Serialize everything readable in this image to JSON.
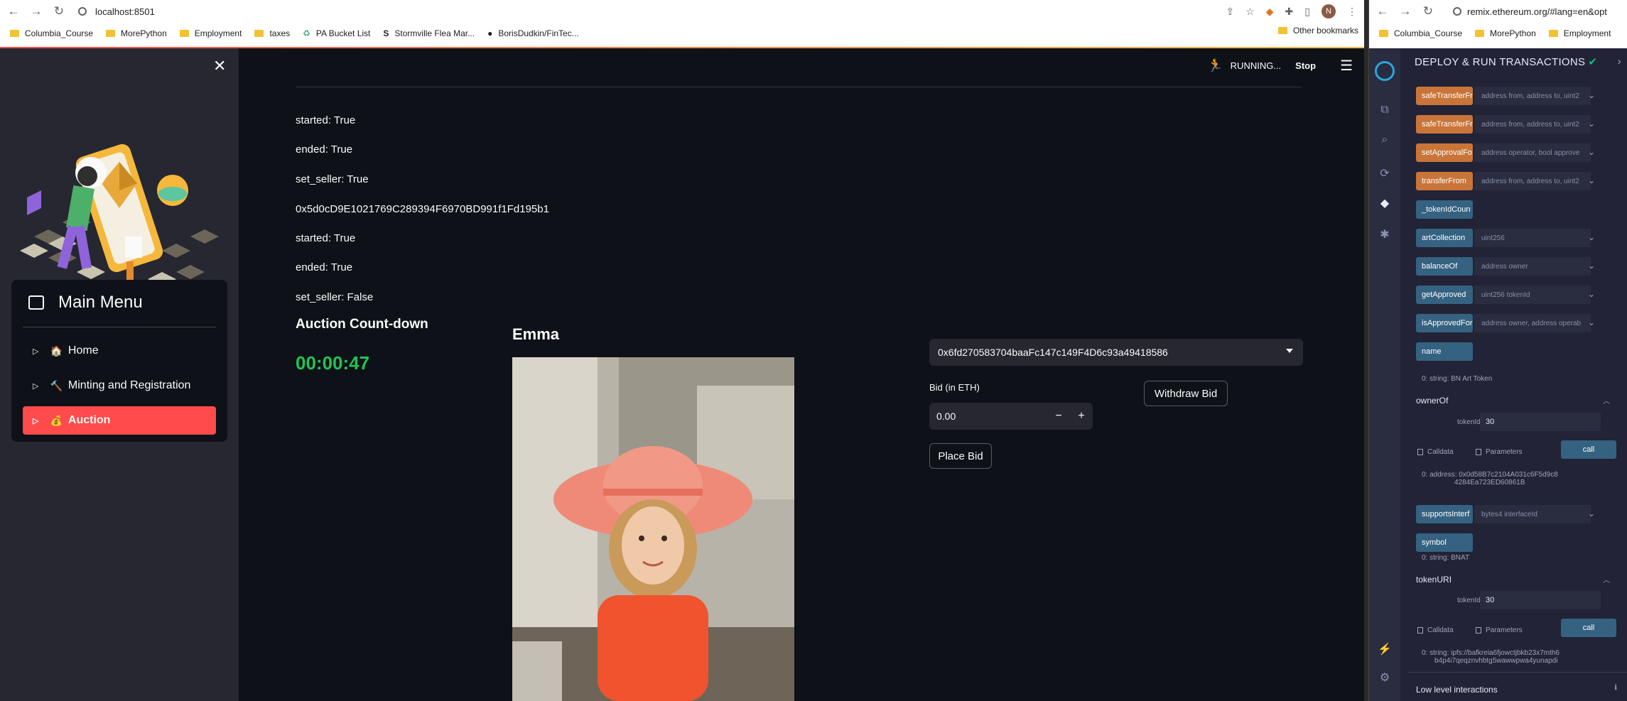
{
  "left_browser": {
    "url": "localhost:8501",
    "bookmarks": [
      "Columbia_Course",
      "MorePython",
      "Employment",
      "taxes",
      "PA Bucket List",
      "Stormville Flea Mar...",
      "BorisDudkin/FinTec..."
    ],
    "other_bookmarks": "Other bookmarks",
    "profile_initial": "N"
  },
  "app": {
    "running_label": "RUNNING...",
    "stop_label": "Stop",
    "sidebar": {
      "menu_title": "Main Menu",
      "items": [
        {
          "emoji": "🏠",
          "label": "Home"
        },
        {
          "emoji": "🔨",
          "label": "Minting and Registration"
        },
        {
          "emoji": "💰",
          "label": "Auction"
        }
      ]
    },
    "status_lines": [
      "started: True",
      "ended: True",
      "set_seller: True",
      "0x5d0cD9E1021769C289394F6970BD991f1Fd195b1",
      "started: True",
      "ended: True",
      "set_seller: False"
    ],
    "countdown_title": "Auction Count-down",
    "countdown_value": "00:00:47",
    "artwork_title": "Emma",
    "account_select": "0x6fd270583704baaFc147c149F4D6c93a49418586",
    "bid_label": "Bid (in ETH)",
    "bid_value": "0.00",
    "withdraw_label": "Withdraw Bid",
    "place_bid_label": "Place Bid"
  },
  "right_browser": {
    "url": "remix.ethereum.org/#lang=en&opt",
    "bookmarks": [
      "Columbia_Course",
      "MorePython",
      "Employment"
    ]
  },
  "remix": {
    "panel_title": "DEPLOY & RUN TRANSACTIONS",
    "functions": [
      {
        "name": "safeTransferFr",
        "params": "address from, address to, uint2",
        "color": "orange"
      },
      {
        "name": "safeTransferFr",
        "params": "address from, address to, uint2",
        "color": "orange"
      },
      {
        "name": "setApprovalFo",
        "params": "address operator, bool approve",
        "color": "orange"
      },
      {
        "name": "transferFrom",
        "params": "address from, address to, uint2",
        "color": "orange"
      },
      {
        "name": "_tokenIdCoun",
        "params": "",
        "color": "blue"
      },
      {
        "name": "artCollection",
        "params": "uint256",
        "color": "blue"
      },
      {
        "name": "balanceOf",
        "params": "address owner",
        "color": "blue"
      },
      {
        "name": "getApproved",
        "params": "uint256 tokenId",
        "color": "blue"
      },
      {
        "name": "isApprovedFor",
        "params": "address owner, address operab",
        "color": "blue"
      },
      {
        "name": "name",
        "params": "",
        "color": "blue"
      }
    ],
    "name_result": "0: string: BN Art Token",
    "ownerOf": {
      "title": "ownerOf",
      "param_label": "tokenId:",
      "param_value": "30",
      "calldata": "Calldata",
      "parameters": "Parameters",
      "call": "call",
      "result_line1": "0:  address: 0x0d58B7c2104A031c6F5d9c8",
      "result_line2": "4284Ea723ED60861B"
    },
    "supportsInterface": {
      "name": "supportsInterf",
      "params": "bytes4 interfaceId"
    },
    "symbol": {
      "name": "symbol",
      "result": "0: string: BNAT"
    },
    "tokenURI": {
      "title": "tokenURI",
      "param_label": "tokenId:",
      "param_value": "30",
      "calldata": "Calldata",
      "parameters": "Parameters",
      "call": "call",
      "result_line1": "0: string: ipfs://bafkreia6fjowctjbkb23x7mth6",
      "result_line2": "b4p4i7qeqznvhbtg5wawwpwa4yunapdi"
    },
    "low_level": "Low level interactions"
  }
}
